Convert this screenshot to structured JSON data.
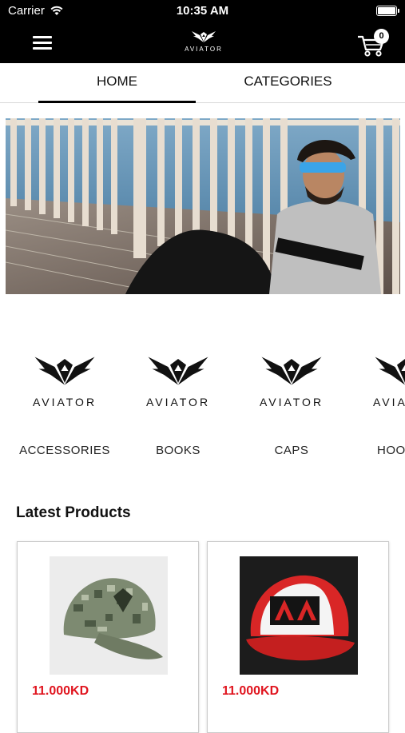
{
  "status_bar": {
    "carrier": "Carrier",
    "time": "10:35 AM"
  },
  "header": {
    "logo_text": "AVIATOR",
    "cart_count": "0"
  },
  "tabs": [
    {
      "label": "HOME",
      "active": true
    },
    {
      "label": "CATEGORIES",
      "active": false
    }
  ],
  "categories": [
    {
      "logo_text": "AVIATOR",
      "name": "ACCESSORIES"
    },
    {
      "logo_text": "AVIATOR",
      "name": "BOOKS"
    },
    {
      "logo_text": "AVIATOR",
      "name": "CAPS"
    },
    {
      "logo_text": "AVIATOR",
      "name": "HOO"
    }
  ],
  "latest": {
    "title": "Latest Products",
    "products": [
      {
        "price": "11.000KD",
        "image": "camo-cap"
      },
      {
        "price": "11.000KD",
        "image": "red-white-trucker-cap"
      }
    ]
  },
  "colors": {
    "bar": "#000000",
    "price": "#e0141e"
  }
}
